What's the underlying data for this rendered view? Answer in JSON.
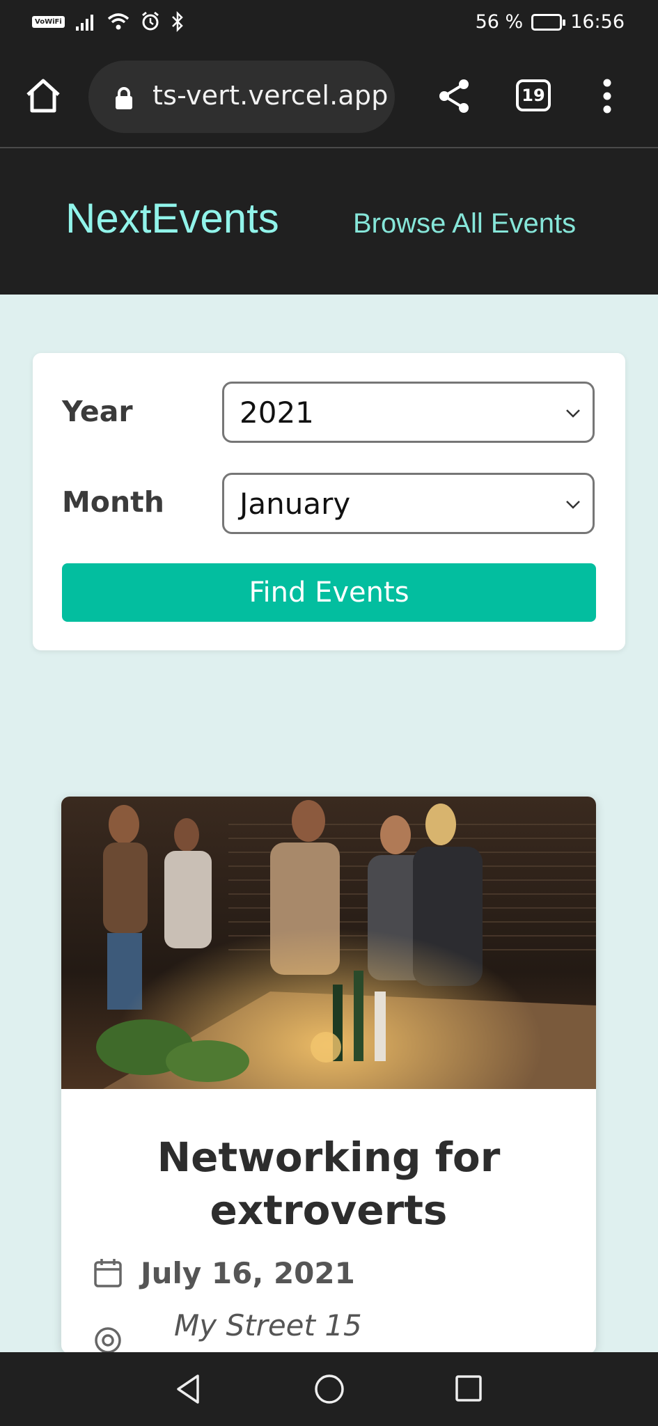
{
  "status_bar": {
    "wifi_label": "VoWiFi",
    "battery_percent": "56 %",
    "time": "16:56"
  },
  "browser": {
    "url": "ts-vert.vercel.app",
    "tab_count": "19"
  },
  "site": {
    "logo": "NextEvents",
    "nav_link": "Browse All Events"
  },
  "filter": {
    "year_label": "Year",
    "year_value": "2021",
    "month_label": "Month",
    "month_value": "January",
    "submit_label": "Find Events"
  },
  "event": {
    "title": "Networking for extroverts",
    "date": "July 16, 2021",
    "address": "My Street 15"
  },
  "colors": {
    "accent": "#03be9f",
    "logo": "#91f4ea",
    "page_bg": "#dff0ef",
    "header_bg": "#202020"
  }
}
